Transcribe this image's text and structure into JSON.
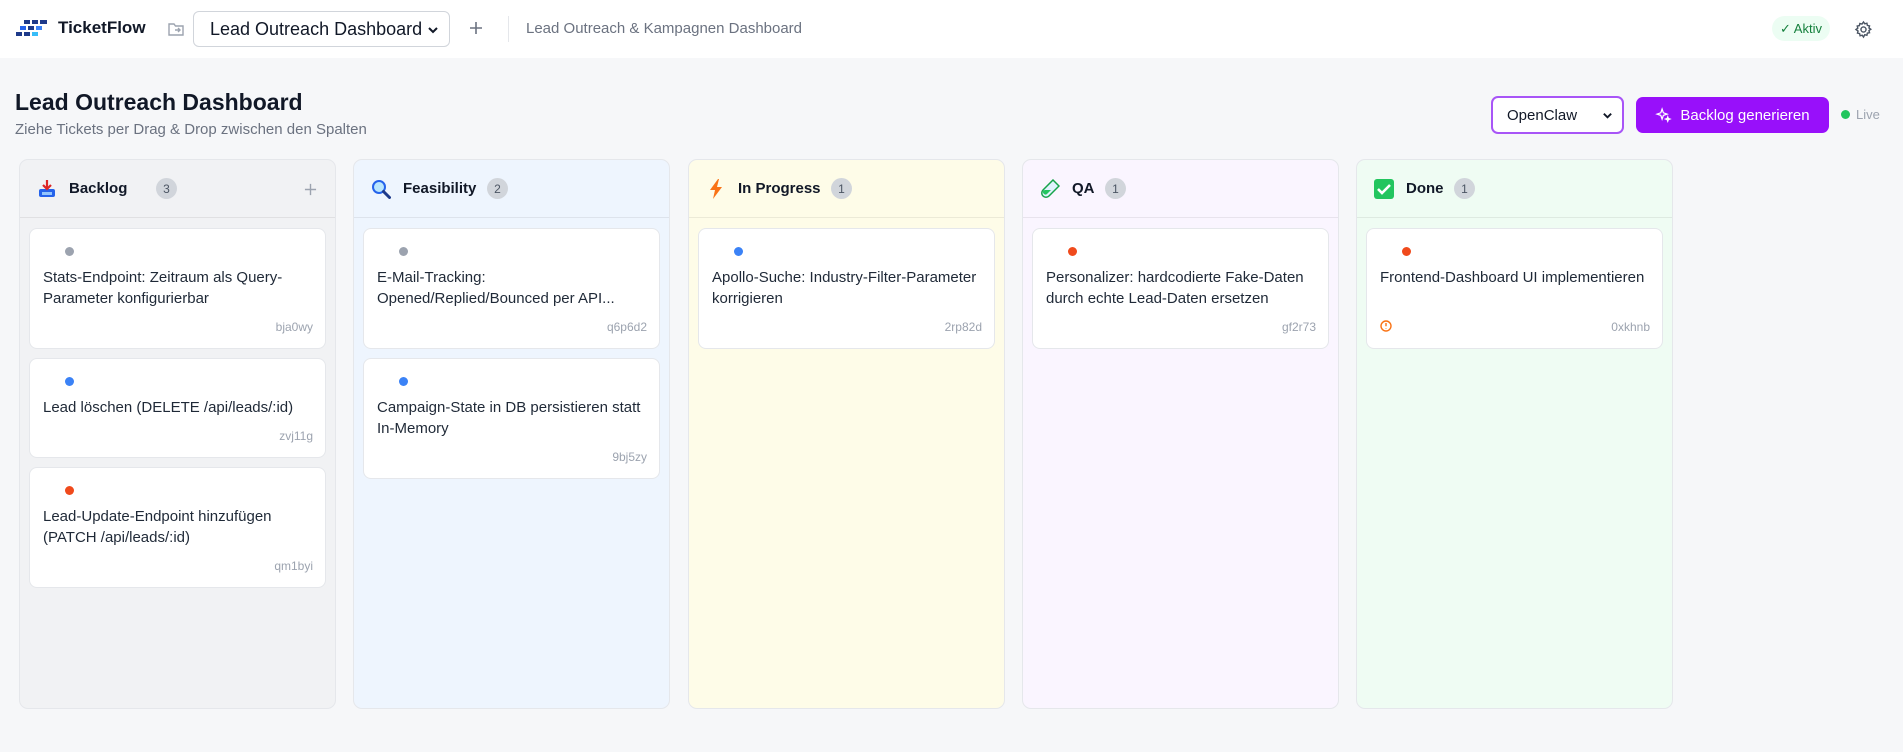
{
  "app": {
    "brand": "TicketFlow",
    "board_selected": "Lead Outreach Dashboard",
    "board_subtitle": "Lead Outreach & Kampagnen Dashboard",
    "status": "✓ Aktiv"
  },
  "header": {
    "title": "Lead Outreach Dashboard",
    "subtitle": "Ziehe Tickets per Drag & Drop zwischen den Spalten",
    "agent_selected": "OpenClaw",
    "generate_label": "Backlog generieren",
    "live_label": "Live"
  },
  "colors": {
    "accent": "#9810fa",
    "dot_gray": "#9ca3af",
    "dot_blue": "#3b82f6",
    "dot_red": "#f04a1c"
  },
  "columns": [
    {
      "title": "Backlog",
      "count": "3",
      "icon": "inbox-tray-icon",
      "cards": [
        {
          "title": "Stats-Endpoint: Zeitraum als Query-Parameter konfigurierbar",
          "id": "bja0wy",
          "priority": "gray"
        },
        {
          "title": "Lead löschen (DELETE /api/leads/:id)",
          "id": "zvj11g",
          "priority": "blue"
        },
        {
          "title": "Lead-Update-Endpoint hinzufügen (PATCH /api/leads/:id)",
          "id": "qm1byi",
          "priority": "red"
        }
      ]
    },
    {
      "title": "Feasibility",
      "count": "2",
      "icon": "magnifier-icon",
      "cards": [
        {
          "title": "E-Mail-Tracking: Opened/Replied/Bounced per API...",
          "id": "q6p6d2",
          "priority": "gray"
        },
        {
          "title": "Campaign-State in DB persistieren statt In-Memory",
          "id": "9bj5zy",
          "priority": "blue"
        }
      ]
    },
    {
      "title": "In Progress",
      "count": "1",
      "icon": "lightning-icon",
      "cards": [
        {
          "title": "Apollo-Suche: Industry-Filter-Parameter korrigieren",
          "id": "2rp82d",
          "priority": "blue"
        }
      ]
    },
    {
      "title": "QA",
      "count": "1",
      "icon": "test-tube-icon",
      "cards": [
        {
          "title": "Personalizer: hardcodierte Fake-Daten durch echte Lead-Daten ersetzen",
          "id": "gf2r73",
          "priority": "red"
        }
      ]
    },
    {
      "title": "Done",
      "count": "1",
      "icon": "check-box-icon",
      "cards": [
        {
          "title": "Frontend-Dashboard UI implementieren",
          "id": "0xkhnb",
          "priority": "red"
        }
      ]
    }
  ]
}
